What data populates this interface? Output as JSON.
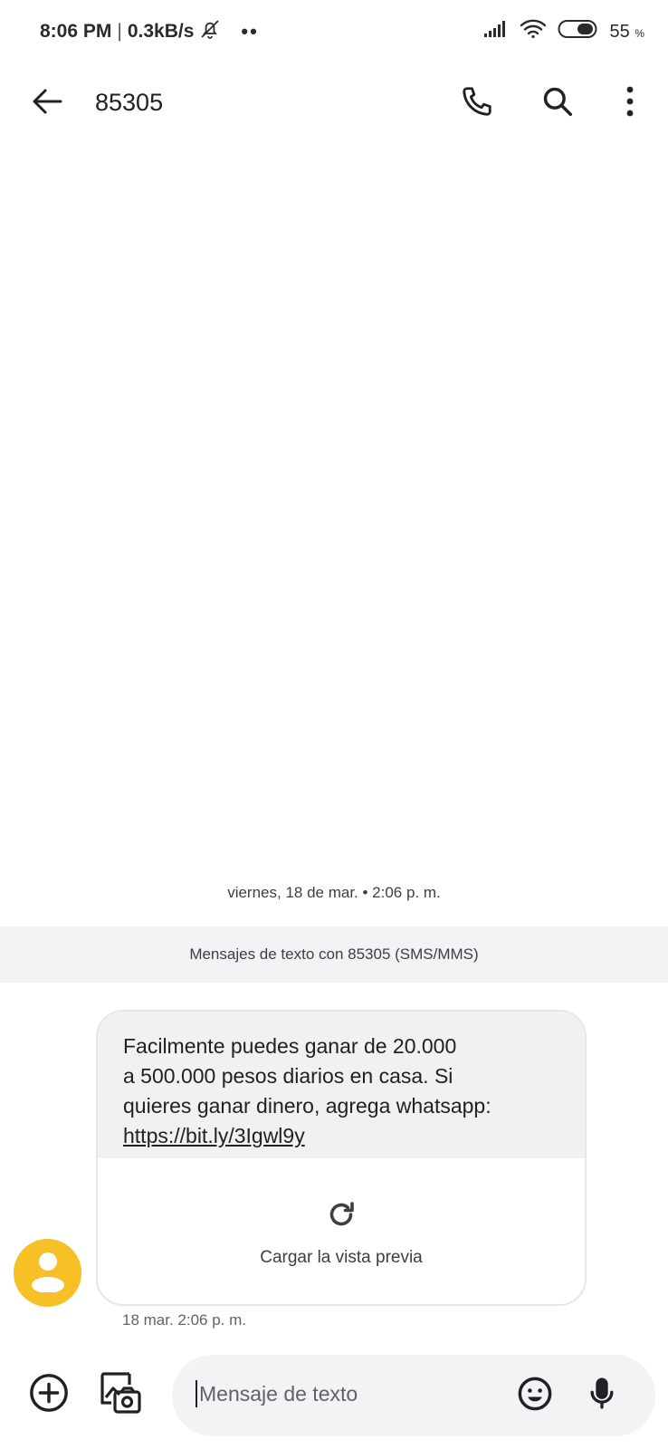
{
  "status_bar": {
    "time": "8:06 PM",
    "separator": "|",
    "network_speed": "0.3kB/s",
    "dots": "••",
    "battery_level": "55",
    "battery_unit": "%",
    "icons": [
      "bell-off-icon",
      "signal-icon",
      "wifi-icon",
      "battery-icon"
    ]
  },
  "app_bar": {
    "title": "85305",
    "actions": [
      "back-arrow-icon",
      "phone-icon",
      "search-icon",
      "more-vert-icon"
    ]
  },
  "conversation": {
    "date_separator": "viernes, 18 de mar. • 2:06 p. m.",
    "banner": "Mensajes de texto con 85305 (SMS/MMS)",
    "message": {
      "lines": [
        "Facilmente puedes ganar de 20.000",
        "a 500.000 pesos diarios en casa. Si",
        "quieres ganar dinero, agrega whatsapp:"
      ],
      "link": "https://bit.ly/3Igwl9y",
      "preview_label": "Cargar la vista previa",
      "timestamp": "18 mar. 2:06 p. m."
    },
    "avatar_color": "#f6c026"
  },
  "composer": {
    "placeholder": "Mensaje de texto",
    "icons": [
      "add-circle-icon",
      "gallery-camera-icon",
      "emoji-icon",
      "mic-icon"
    ]
  }
}
